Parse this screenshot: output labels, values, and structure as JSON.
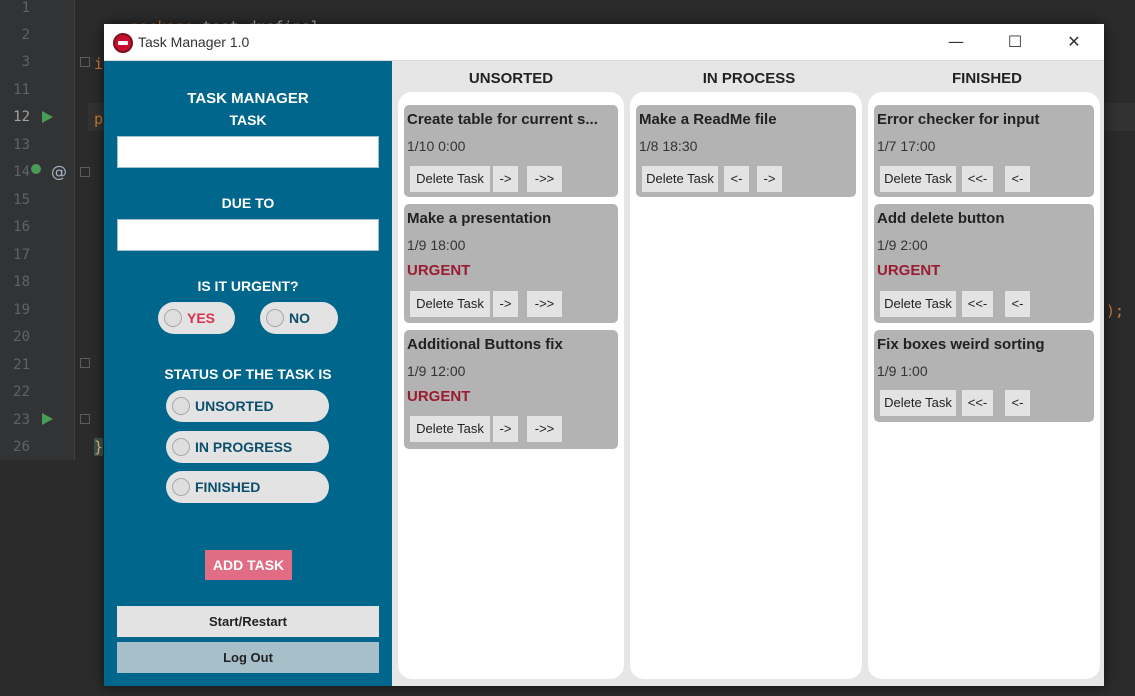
{
  "ide": {
    "line_numbers": [
      "1",
      "2",
      "3",
      "11",
      "12",
      "13",
      "14",
      "15",
      "16",
      "17",
      "18",
      "19",
      "20",
      "21",
      "22",
      "23",
      "26"
    ],
    "code_line_1": {
      "keyword": "package",
      "rest": " test.dmsfinal;"
    },
    "partial_3": "i",
    "partial_12": "p",
    "brace_26": "}",
    "partial_19": ");",
    "at_sign": "@"
  },
  "window": {
    "title": "Task Manager 1.0",
    "minimize_glyph": "—",
    "maximize_glyph": "☐",
    "close_glyph": "✕"
  },
  "sidebar": {
    "app_title": "TASK MANAGER",
    "task_label": "TASK",
    "task_value": "",
    "due_label": "DUE  TO",
    "due_value": "",
    "urgent_label": "IS IT URGENT?",
    "urgent_yes": "YES",
    "urgent_no": "NO",
    "status_label": "STATUS OF THE TASK IS",
    "status_options": [
      "UNSORTED",
      "IN PROGRESS",
      "FINISHED"
    ],
    "add_button": "ADD TASK",
    "start_button": "Start/Restart",
    "logout_button": "Log Out"
  },
  "colors": {
    "sidebar": "#00668c",
    "add_button": "#e16d84",
    "urgent_text": "#9b1b30",
    "card": "#b3b3b3"
  },
  "board": {
    "columns": [
      {
        "header": "UNSORTED",
        "cards": [
          {
            "title": "Create table for current s...",
            "date": "1/10 0:00",
            "urgent": "",
            "buttons": [
              "Delete Task",
              "->",
              "->>"
            ]
          },
          {
            "title": "Make a presentation",
            "date": "1/9 18:00",
            "urgent": "URGENT",
            "buttons": [
              "Delete Task",
              "->",
              "->>"
            ]
          },
          {
            "title": "Additional Buttons fix",
            "date": "1/9 12:00",
            "urgent": "URGENT",
            "buttons": [
              "Delete Task",
              "->",
              "->>"
            ]
          }
        ]
      },
      {
        "header": "IN PROCESS",
        "cards": [
          {
            "title": "Make a ReadMe file",
            "date": "1/8 18:30",
            "urgent": "",
            "buttons": [
              "Delete Task",
              "<-",
              "->"
            ]
          }
        ]
      },
      {
        "header": "FINISHED",
        "cards": [
          {
            "title": "Error checker for input",
            "date": "1/7 17:00",
            "urgent": "",
            "buttons": [
              "Delete Task",
              "<<-",
              "<-"
            ]
          },
          {
            "title": "Add delete button",
            "date": "1/9 2:00",
            "urgent": "URGENT",
            "buttons": [
              "Delete Task",
              "<<-",
              "<-"
            ]
          },
          {
            "title": "Fix boxes weird sorting",
            "date": "1/9 1:00",
            "urgent": "",
            "buttons": [
              "Delete Task",
              "<<-",
              "<-"
            ]
          }
        ]
      }
    ]
  }
}
